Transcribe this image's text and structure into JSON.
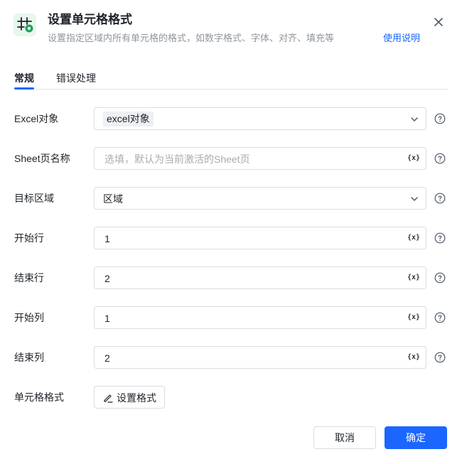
{
  "dialog": {
    "title": "设置单元格格式",
    "subtitle": "设置指定区域内所有单元格的格式，如数字格式、字体、对齐、填充等",
    "help_link": "使用说明",
    "icon": "cell-format-icon",
    "close_icon": "close-icon"
  },
  "tabs": [
    {
      "label": "常规",
      "active": true
    },
    {
      "label": "错误处理",
      "active": false
    }
  ],
  "fields": {
    "excel_object": {
      "label": "Excel对象",
      "value": "excel对象"
    },
    "sheet_name": {
      "label": "Sheet页名称",
      "placeholder": "选填，默认为当前激活的Sheet页"
    },
    "target_area": {
      "label": "目标区域",
      "value": "区域"
    },
    "start_row": {
      "label": "开始行",
      "value": "1"
    },
    "end_row": {
      "label": "结束行",
      "value": "2"
    },
    "start_col": {
      "label": "开始列",
      "value": "1"
    },
    "end_col": {
      "label": "结束列",
      "value": "2"
    },
    "cell_format": {
      "label": "单元格格式",
      "button": "设置格式"
    }
  },
  "variable_button": "{x}",
  "footer": {
    "cancel": "取消",
    "ok": "确定"
  },
  "colors": {
    "accent": "#1a66ff",
    "icon_green": "#1aa35c",
    "border": "#d9dce1"
  }
}
